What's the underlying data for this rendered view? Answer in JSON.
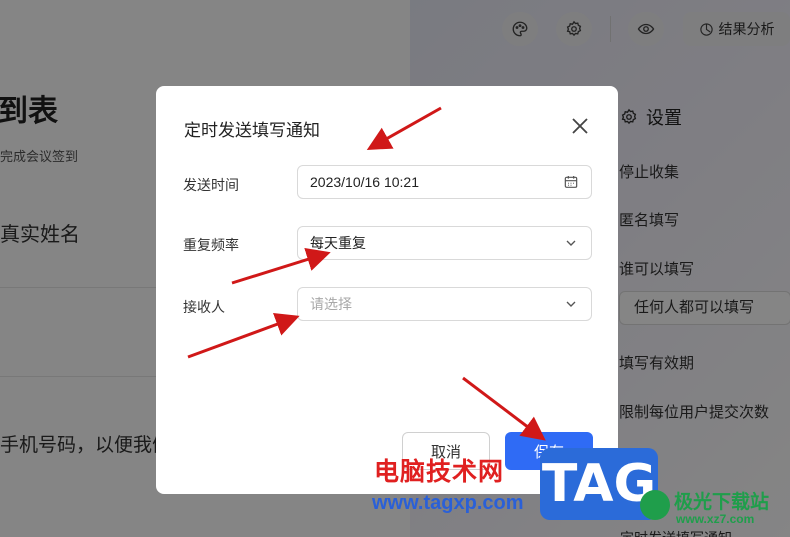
{
  "header": {
    "result_analysis_label": "结果分析"
  },
  "form": {
    "title": "到表",
    "description": "完成会议签到",
    "q1": "真实姓名",
    "q2": "手机号码，以便我们"
  },
  "settings": {
    "title": "设置",
    "stop_collect": "停止收集",
    "anonymous": "匿名填写",
    "who_can_fill": "谁可以填写",
    "who_can_fill_value": "任何人都可以填写",
    "valid_period": "填写有效期",
    "limit_submit": "限制每位用户提交次数",
    "timed_notify": "定时发送填写通知"
  },
  "modal": {
    "title": "定时发送填写通知",
    "send_time_label": "发送时间",
    "send_time_value": "2023/10/16 10:21",
    "repeat_label": "重复频率",
    "repeat_value": "每天重复",
    "receiver_label": "接收人",
    "receiver_placeholder": "请选择",
    "cancel_label": "取消",
    "save_label": "保存"
  },
  "watermark": {
    "site_name": "电脑技术网",
    "site_url": "www.tagxp.com",
    "tag_text": "TAG",
    "logo_text": "极光下载站",
    "logo_url": "www.xz7.com"
  },
  "colors": {
    "primary": "#2f6bf5",
    "annotation_arrow": "#d01818",
    "overlay": "rgba(0,0,0,0.48)"
  }
}
